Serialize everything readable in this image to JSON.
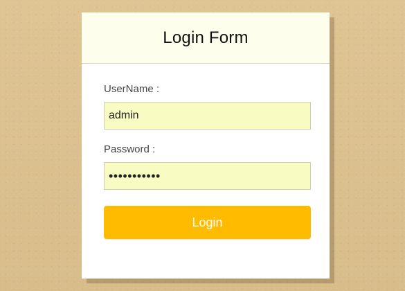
{
  "login_form": {
    "title": "Login Form",
    "username": {
      "label": "UserName :",
      "value": "admin"
    },
    "password": {
      "label": "Password :",
      "value": "•••••••••••"
    },
    "submit_label": "Login"
  },
  "colors": {
    "background": "#dcc190",
    "header_background": "#fefeec",
    "input_background": "#f8fcc2",
    "button_background": "#ffbb00",
    "button_text": "#ffffff"
  }
}
